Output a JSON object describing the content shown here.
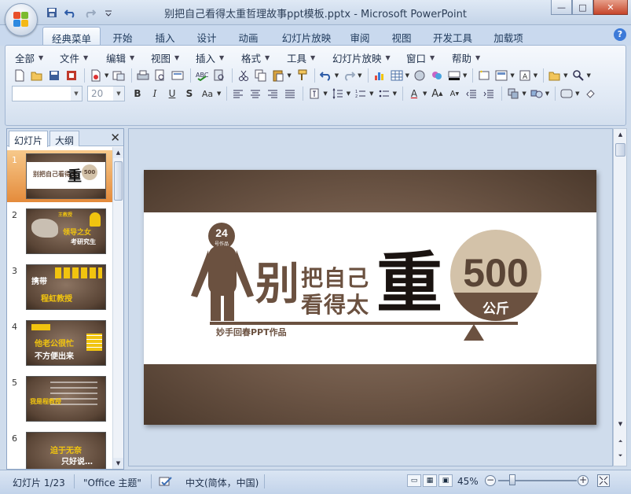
{
  "window": {
    "title": "别把自己看得太重哲理故事ppt模板.pptx - Microsoft PowerPoint",
    "controls": {
      "minimize": "—",
      "maximize": "□",
      "close": "✕"
    }
  },
  "ribbon_tabs": [
    "经典菜单",
    "开始",
    "插入",
    "设计",
    "动画",
    "幻灯片放映",
    "审阅",
    "视图",
    "开发工具",
    "加载项"
  ],
  "menubar": [
    "全部",
    "文件",
    "编辑",
    "视图",
    "插入",
    "格式",
    "工具",
    "幻灯片放映",
    "窗口",
    "帮助"
  ],
  "font_size_value": "20",
  "left_panel": {
    "tabs": [
      "幻灯片",
      "大纲"
    ],
    "close_glyph": "✕",
    "thumbnails": [
      {
        "num": "1",
        "texts": [
          "别把自己看得太",
          "重",
          "500"
        ]
      },
      {
        "num": "2",
        "texts": [
          "王教授",
          "领导之女",
          "考研究生"
        ]
      },
      {
        "num": "3",
        "texts": [
          "携带",
          "程虹教授"
        ]
      },
      {
        "num": "4",
        "texts": [
          "他老公很忙",
          "不方便出来"
        ]
      },
      {
        "num": "5",
        "texts": [
          "我是程教授"
        ]
      },
      {
        "num": "6",
        "texts": [
          "迫于无奈",
          "只好说…"
        ]
      }
    ]
  },
  "slide": {
    "badge_num": "24",
    "badge_sub": "号作品",
    "big_char_1": "别",
    "line1": "把自己",
    "line2": "看得太",
    "big_char_2": "重",
    "weight_num": "500",
    "weight_unit": "公斤",
    "author": "妙手回春PPT作品"
  },
  "status": {
    "slide_info": "幻灯片 1/23",
    "theme": "\"Office 主题\"",
    "language": "中文(简体，中国)",
    "zoom": "45%"
  }
}
